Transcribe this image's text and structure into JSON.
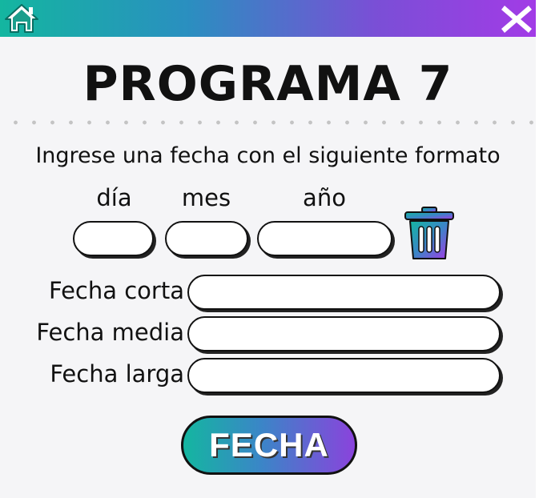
{
  "header": {
    "home_icon": "home-icon",
    "close_icon": "close-icon"
  },
  "title": "PROGRAMA 7",
  "instruction": "Ingrese una fecha con el siguiente formato",
  "date_labels": {
    "day": "día",
    "month": "mes",
    "year": "año"
  },
  "inputs": {
    "day": "",
    "month": "",
    "year": ""
  },
  "trash_icon": "trash-icon",
  "outputs": [
    {
      "label": "Fecha corta",
      "value": ""
    },
    {
      "label": "Fecha media",
      "value": ""
    },
    {
      "label": "Fecha larga",
      "value": ""
    }
  ],
  "button_label": "FECHA",
  "colors": {
    "gradient_start": "#14b6a0",
    "gradient_end": "#a23be6",
    "background": "#f5f5f7"
  }
}
